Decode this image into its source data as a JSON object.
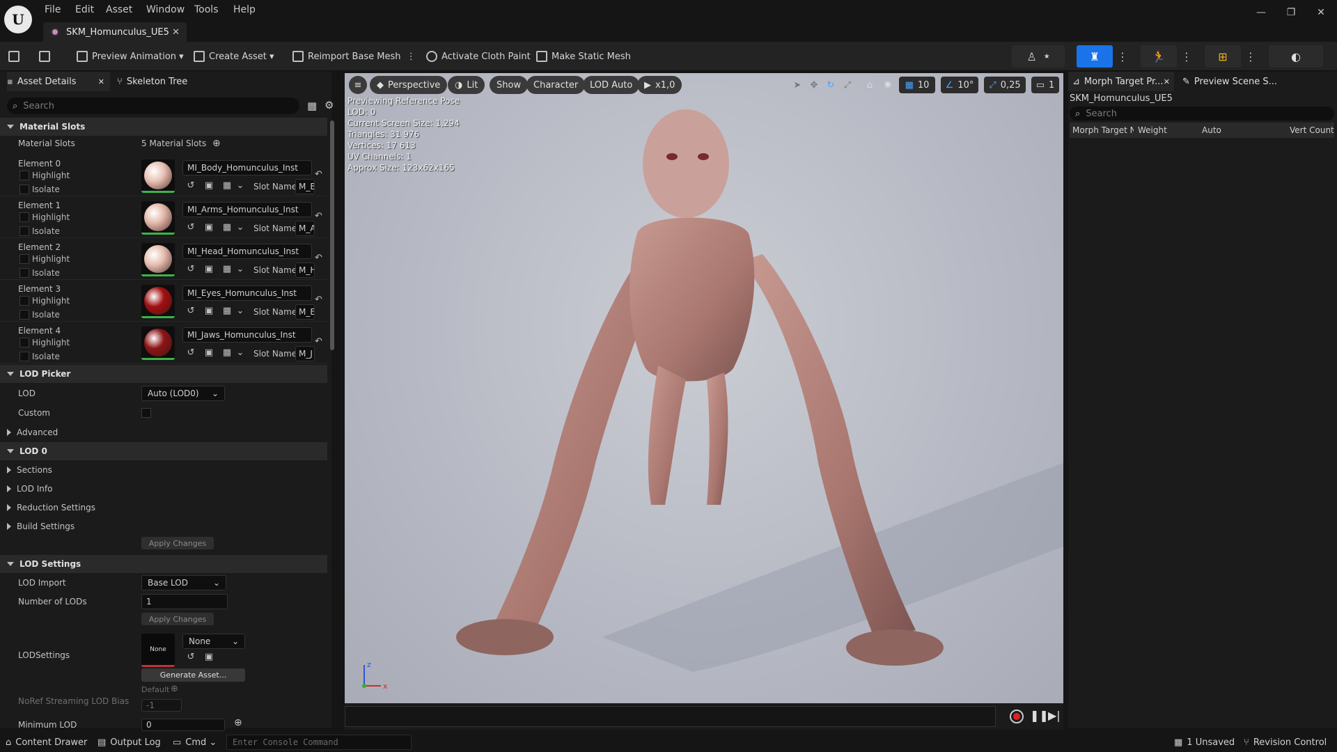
{
  "window": {
    "menu": [
      "File",
      "Edit",
      "Asset",
      "Window",
      "Tools",
      "Help"
    ],
    "tab_title": "SKM_Homunculus_UE5"
  },
  "toolbar": {
    "preview_animation": "Preview Animation",
    "create_asset": "Create Asset",
    "reimport": "Reimport Base Mesh",
    "cloth_paint": "Activate Cloth Paint",
    "static_mesh": "Make Static Mesh"
  },
  "left_panel": {
    "tab_asset_details": "Asset Details",
    "tab_skeleton_tree": "Skeleton Tree",
    "search_placeholder": "Search",
    "material_slots_section": "Material Slots",
    "material_slots_label": "Material Slots",
    "material_slots_count": "5 Material Slots",
    "highlight": "Highlight",
    "isolate": "Isolate",
    "slot_name_label": "Slot Name",
    "elements": [
      {
        "label": "Element 0",
        "material": "MI_Body_Homunculus_Inst",
        "slot": "M_B",
        "color": "#e8c2b4"
      },
      {
        "label": "Element 1",
        "material": "MI_Arms_Homunculus_Inst",
        "slot": "M_A",
        "color": "#e3b9aa"
      },
      {
        "label": "Element 2",
        "material": "MI_Head_Homunculus_Inst",
        "slot": "M_H",
        "color": "#e6bfb0"
      },
      {
        "label": "Element 3",
        "material": "MI_Eyes_Homunculus_Inst",
        "slot": "M_E",
        "color": "#a10f12"
      },
      {
        "label": "Element 4",
        "material": "MI_Jaws_Homunculus_Inst",
        "slot": "M_J",
        "color": "#8c1416"
      }
    ],
    "lod_picker": {
      "section": "LOD Picker",
      "lod_label": "LOD",
      "lod_value": "Auto (LOD0)",
      "custom_label": "Custom",
      "advanced": "Advanced"
    },
    "lod0": {
      "section": "LOD 0",
      "sections": "Sections",
      "lod_info": "LOD Info",
      "reduction": "Reduction Settings",
      "build": "Build Settings",
      "apply": "Apply Changes"
    },
    "lod_settings": {
      "section": "LOD Settings",
      "lod_import_label": "LOD Import",
      "lod_import_value": "Base LOD",
      "num_lods_label": "Number of LODs",
      "num_lods_value": "1",
      "apply": "Apply Changes",
      "lodsettings_label": "LODSettings",
      "lodsettings_thumb": "None",
      "lodsettings_value": "None",
      "generate": "Generate Asset...",
      "noref_label": "NoRef Streaming LOD Bias",
      "noref_default": "Default",
      "noref_value": "-1",
      "min_lod_label": "Minimum LOD",
      "min_lod_value": "0"
    }
  },
  "viewport": {
    "perspective": "Perspective",
    "lit": "Lit",
    "show": "Show",
    "character": "Character",
    "lod_auto": "LOD Auto",
    "play_rate": "x1,0",
    "grid_snap": "10",
    "angle_snap": "10°",
    "scale_snap": "0,25",
    "camera_speed": "1",
    "stats": [
      "Previewing Reference Pose",
      "LOD: 0",
      "Current Screen Size: 1,294",
      "Triangles: 31 976",
      "Vertices: 17 613",
      "UV Channels: 1",
      "Approx Size: 123x62x165"
    ],
    "axis_x": "x",
    "axis_z": "z"
  },
  "right_panel": {
    "tab_morph": "Morph Target Pr...",
    "tab_scene": "Preview Scene S...",
    "asset_name": "SKM_Homunculus_UE5",
    "search_placeholder": "Search",
    "columns": [
      "Morph Target N",
      "Weight",
      "Auto",
      "Vert Count"
    ]
  },
  "statusbar": {
    "content_drawer": "Content Drawer",
    "output_log": "Output Log",
    "cmd": "Cmd",
    "console_placeholder": "Enter Console Command",
    "unsaved": "1 Unsaved",
    "revision_control": "Revision Control"
  },
  "colors": {
    "accent_blue": "#1a73e8",
    "green_bar": "#3bb34a",
    "panel_bg": "#1b1b1b"
  }
}
